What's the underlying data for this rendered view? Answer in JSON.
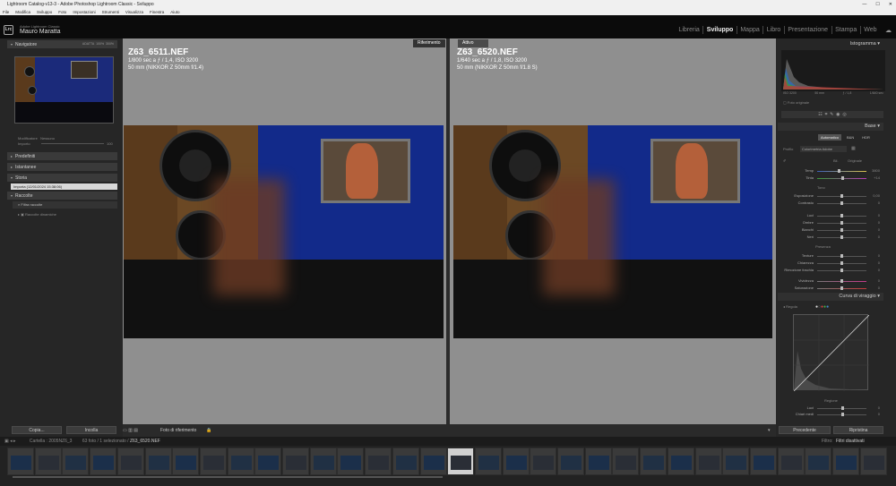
{
  "window": {
    "title": "Lightroom Catalog-v13-3 - Adobe Photoshop Lightroom Classic - Sviluppo",
    "controls": [
      "—",
      "☐",
      "✕"
    ]
  },
  "menu": [
    "File",
    "Modifica",
    "Sviluppo",
    "Foto",
    "Impostazioni",
    "Strumenti",
    "Visualizza",
    "Finestra",
    "Aiuto"
  ],
  "identity": {
    "logo": "Lrc",
    "app_small": "Adobe Lightroom Classic",
    "user": "Mauro Maratta",
    "modules": [
      "Libreria",
      "Sviluppo",
      "Mappa",
      "Libro",
      "Presentazione",
      "Stampa",
      "Web"
    ],
    "active_module": "Sviluppo"
  },
  "left": {
    "navigator": {
      "title": "Navigatore",
      "zoom": [
        "ADATTA",
        "100%",
        "300%"
      ]
    },
    "modifier": {
      "labels": [
        "Modificatore",
        "Nessuno"
      ],
      "amount": "Importo",
      "value": "100"
    },
    "panels": [
      "Predefiniti",
      "Istantanee",
      "Storia",
      "Raccolte"
    ],
    "history_item": "Importa (12/01/2024 15:38:06)",
    "collections": [
      "Filtra raccolte",
      "Raccolte dinamiche"
    ],
    "copy_btn": "Copia...",
    "reset_btn": "Incolla"
  },
  "center": {
    "ref_label": "Riferimento",
    "active_label": "Attivo",
    "ref": {
      "file": "Z63_6511.NEF",
      "exposure": "1/800 sec a ƒ / 1,4, ISO 3200",
      "lens": "50 mm (NIKKOR Z 50mm f/1.4)"
    },
    "active": {
      "file": "Z63_6520.NEF",
      "exposure": "1/640 sec a ƒ / 1,8, ISO 3200",
      "lens": "50 mm (NIKKOR Z 50mm f/1.8 S)"
    },
    "bottom_label": "Foto di riferimento"
  },
  "right": {
    "histogram_title": "Istogramma",
    "hist_info": [
      "ISO 3200",
      "50 mm",
      "ƒ / 1,8",
      "1/640 sec"
    ],
    "original_photo": "Foto originale",
    "base_title": "Base",
    "treat_tabs": [
      "Automatico",
      "B&N",
      "HDR"
    ],
    "profile_label": "Profilo",
    "profile_value": "Colorimetria Adobe",
    "wb_label": "Bil.",
    "wb_value": "Originale",
    "sliders": [
      {
        "label": "Temp",
        "val": "3800",
        "pos": 0.45
      },
      {
        "label": "Tinta",
        "val": "+14",
        "pos": 0.52
      },
      {
        "label": "Esposizione",
        "val": "0,00",
        "pos": 0.5
      },
      {
        "label": "Contrasto",
        "val": "0",
        "pos": 0.5
      },
      {
        "label": "Luci",
        "val": "0",
        "pos": 0.5
      },
      {
        "label": "Ombre",
        "val": "0",
        "pos": 0.5
      },
      {
        "label": "Bianchi",
        "val": "0",
        "pos": 0.5
      },
      {
        "label": "Neri",
        "val": "0",
        "pos": 0.5
      },
      {
        "label": "Texture",
        "val": "0",
        "pos": 0.5
      },
      {
        "label": "Chiarezza",
        "val": "0",
        "pos": 0.5
      },
      {
        "label": "Rimozione foschia",
        "val": "0",
        "pos": 0.5
      },
      {
        "label": "Vividezza",
        "val": "0",
        "pos": 0.5
      },
      {
        "label": "Saturazione",
        "val": "0",
        "pos": 0.5
      }
    ],
    "tone_label": "Tono",
    "presence_label": "Presenza",
    "curve_title": "Curva di viraggio",
    "curve_type": "Regola",
    "region_label": "Regione",
    "curve_sliders": [
      "Luci",
      "Chiari medi"
    ],
    "prev_btn": "Precedente",
    "reset_btn": "Ripristina"
  },
  "filmstrip": {
    "info": "Cartella : 2005NZ6_3",
    "count": "63 foto / 1 selezionato /",
    "selected": "Z63_6520.NEF",
    "filter_label": "Filtro:",
    "filter_value": "Filtri disattivati"
  }
}
